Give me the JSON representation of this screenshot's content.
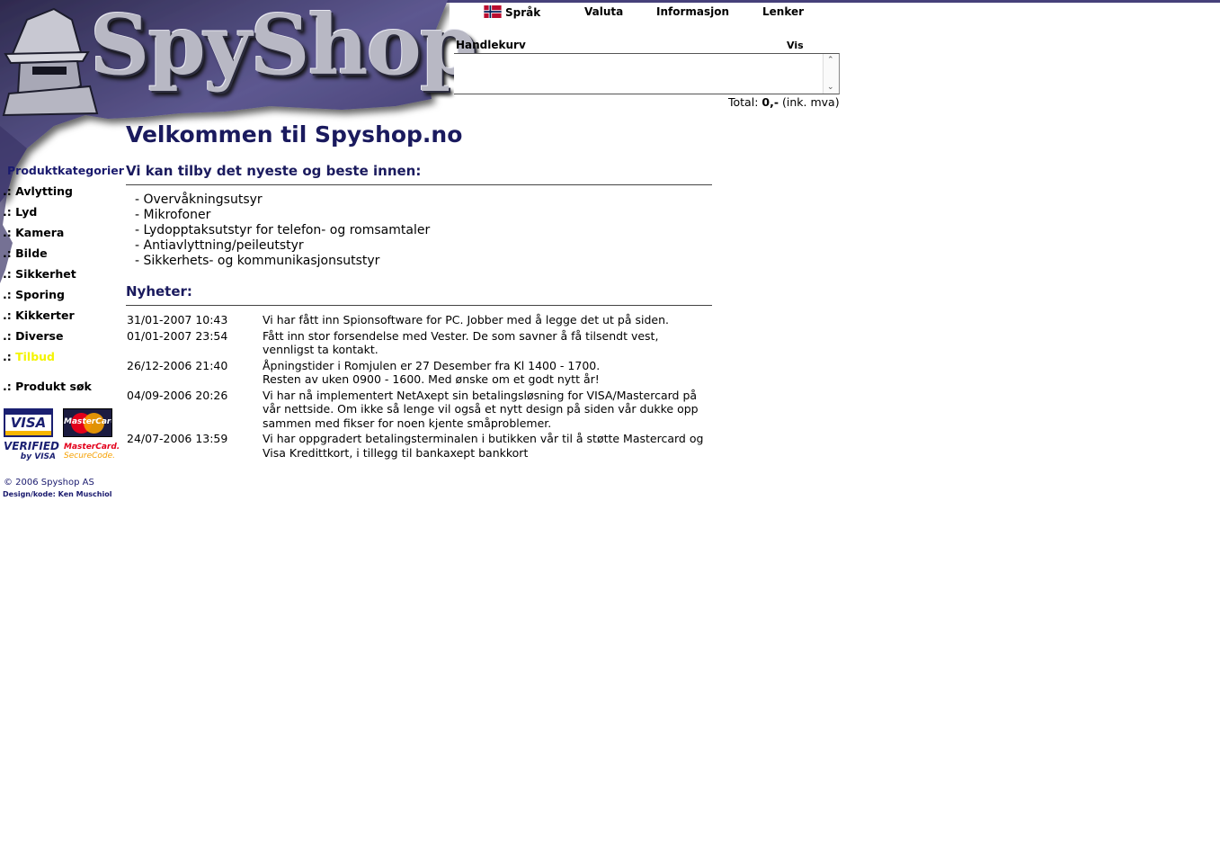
{
  "brand": {
    "logo_text": "SpyShop"
  },
  "topnav": [
    {
      "label": "Språk",
      "icon": "norway-flag-icon"
    },
    {
      "label": "Valuta"
    },
    {
      "label": "Informasjon"
    },
    {
      "label": "Lenker"
    }
  ],
  "cart": {
    "title": "Handlekurv",
    "show_label": "Vis",
    "total_label": "Total:",
    "total_value": "0,-",
    "total_suffix": "(ink. mva)"
  },
  "sidebar": {
    "title": "Produktkategorier",
    "prefix": ".:",
    "categories": [
      "Avlytting",
      "Lyd",
      "Kamera",
      "Bilde",
      "Sikkerhet",
      "Sporing",
      "Kikkerter",
      "Diverse",
      "Tilbud"
    ],
    "search_label": "Produkt søk"
  },
  "payment": {
    "visa": "VISA",
    "mastercard": "MasterCard",
    "verified_line1": "VERIFIED",
    "verified_line2": "by VISA",
    "securecode_line1": "MasterCard.",
    "securecode_line2": "SecureCode."
  },
  "footer": {
    "copyright": "© 2006 Spyshop AS",
    "credit": "Design/kode: Ken Muschiol"
  },
  "main": {
    "title": "Velkommen til Spyshop.no",
    "offer_heading": "Vi kan tilby det nyeste og beste innen:",
    "offer_items": [
      "- Overvåkningsutsyr",
      "- Mikrofoner",
      "- Lydopptaksutstyr for telefon- og romsamtaler",
      "- Antiavlyttning/peileutstyr",
      "- Sikkerhets- og kommunikasjonsutstyr"
    ],
    "news_heading": "Nyheter:",
    "news": [
      {
        "date": "31/01-2007 10:43",
        "lines": [
          "Vi har fått inn Spionsoftware for PC. Jobber med å legge det ut på siden."
        ]
      },
      {
        "date": "01/01-2007 23:54",
        "lines": [
          "Fått inn stor forsendelse med Vester. De som savner å få tilsendt vest, vennligst ta kontakt."
        ]
      },
      {
        "date": "26/12-2006 21:40",
        "lines": [
          "Åpningstider i Romjulen er 27 Desember fra Kl 1400 - 1700.",
          "Resten av uken 0900 - 1600. Med ønske om et godt nytt år!"
        ]
      },
      {
        "date": "04/09-2006 20:26",
        "lines": [
          "Vi har nå implementert NetAxept sin betalingsløsning for VISA/Mastercard på vår nettside. Om ikke så lenge vil også et nytt design på siden vår dukke opp sammen med fikser for noen kjente småproblemer."
        ]
      },
      {
        "date": "24/07-2006 13:59",
        "lines": [
          "Vi har oppgradert betalingsterminalen i butikken vår til å støtte Mastercard og Visa Kredittkort, i tillegg til bankaxept bankkort"
        ]
      }
    ]
  }
}
